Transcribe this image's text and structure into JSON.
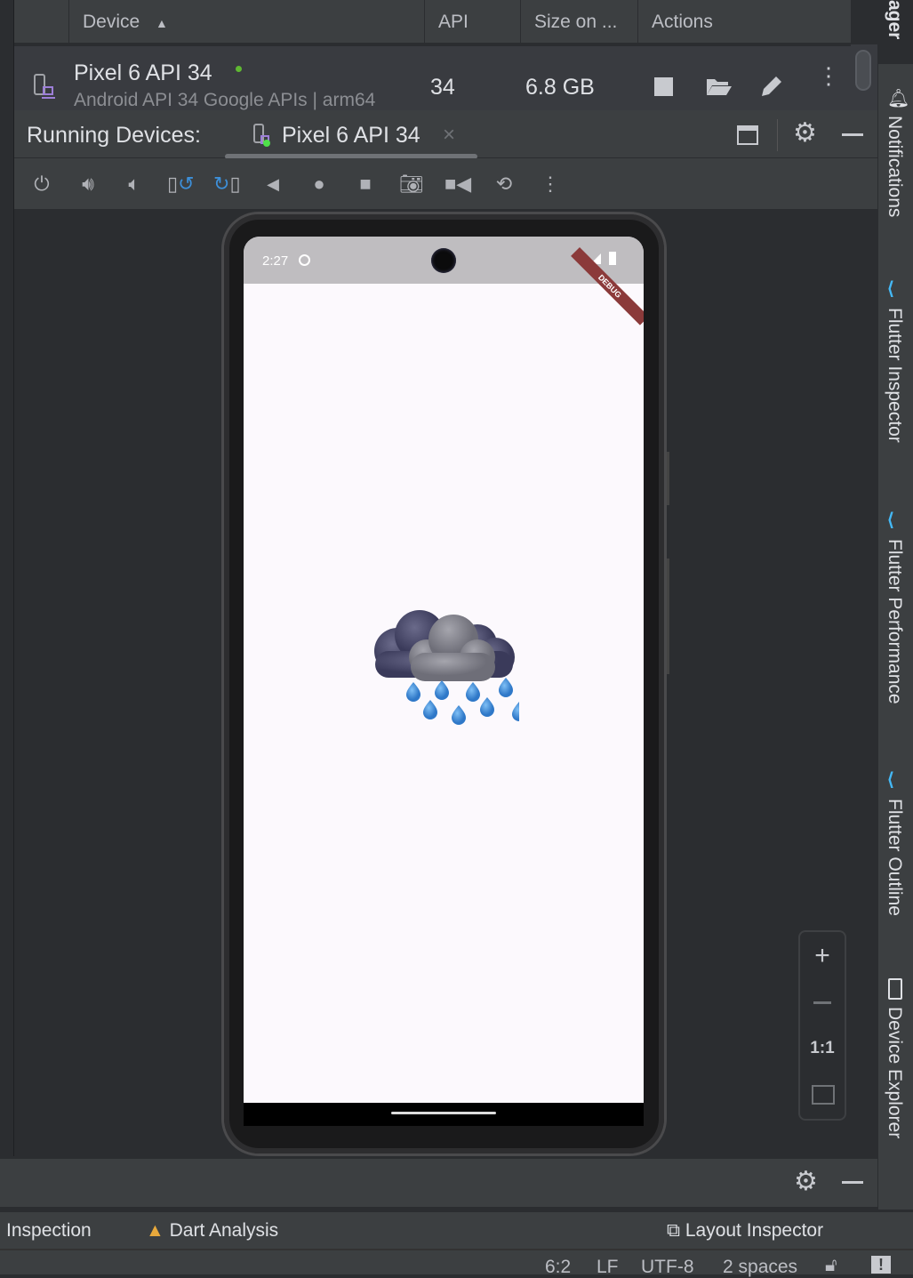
{
  "device_manager": {
    "side_label": "ager",
    "columns": [
      "Device",
      "API",
      "Size on ...",
      "Actions"
    ],
    "sort_indicator": "ascending",
    "rows": [
      {
        "name": "Pixel 6 API 34",
        "subtitle": "Android API 34 Google APIs | arm64",
        "api": "34",
        "size": "6.8 GB",
        "status_color": "#5fb832"
      }
    ],
    "actions": [
      "stop-icon",
      "folder-open-icon",
      "edit-icon",
      "more-icon"
    ]
  },
  "running_devices": {
    "title": "Running Devices:",
    "tab_label": "Pixel 6 API 34",
    "toolbar": [
      "power-icon",
      "volume-up-icon",
      "volume-down-icon",
      "rotate-left-icon",
      "rotate-right-icon",
      "back-icon",
      "home-icon",
      "overview-icon",
      "screenshot-icon",
      "screen-record-icon",
      "snapshot-icon",
      "more-icon"
    ]
  },
  "emulator": {
    "time": "2:27",
    "debug_banner": "DEBUG",
    "app_content": "rain-cloud-image"
  },
  "zoom_controls": {
    "actual_size": "1:1"
  },
  "right_tools": [
    "Notifications",
    "Flutter Inspector",
    "Flutter Performance",
    "Flutter Outline",
    "Device Explorer"
  ],
  "tool_windows": {
    "left": "Inspection",
    "dart": "Dart Analysis",
    "layout": "Layout Inspector"
  },
  "status": {
    "position": "6:2",
    "line_sep": "LF",
    "encoding": "UTF-8",
    "indent": "2 spaces"
  },
  "colors": {
    "accent_blue": "#3d8fd8",
    "debug_red": "#8b3a3a",
    "flutter_blue": "#44b8f5"
  }
}
